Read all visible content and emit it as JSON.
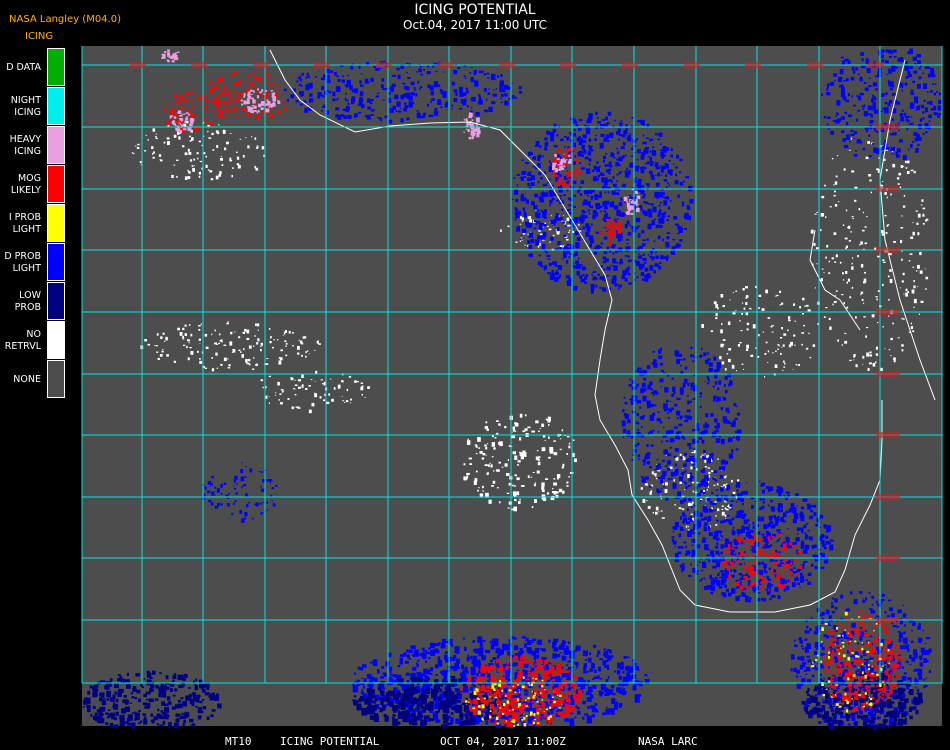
{
  "header": {
    "source": "NASA Langley (M04.0)",
    "product": "ICING",
    "title": "ICING POTENTIAL",
    "subtitle": "Oct.04, 2017 11:00 UTC"
  },
  "legend": [
    {
      "label_lines": [
        "D DATA"
      ],
      "color": "#00b000"
    },
    {
      "label_lines": [
        "NIGHT",
        "ICING"
      ],
      "color": "#00eeee"
    },
    {
      "label_lines": [
        "HEAVY",
        "ICING"
      ],
      "color": "#e8a0e0"
    },
    {
      "label_lines": [
        "MOG",
        "LIKELY"
      ],
      "color": "#ff0000"
    },
    {
      "label_lines": [
        "I PROB",
        "LIGHT"
      ],
      "color": "#ffff00"
    },
    {
      "label_lines": [
        "D PROB",
        "LIGHT"
      ],
      "color": "#0000ff"
    },
    {
      "label_lines": [
        "LOW",
        "PROB"
      ],
      "color": "#000080"
    },
    {
      "label_lines": [
        "NO",
        "RETRVL"
      ],
      "color": "#ffffff"
    },
    {
      "label_lines": [
        "NONE"
      ],
      "color": "#4d4d4d"
    }
  ],
  "footer": {
    "satellite": "MT10",
    "product": "ICING POTENTIAL",
    "date": "OCT 04, 2017 11:00Z",
    "agency": "NASA LARC"
  },
  "colors": {
    "background": "#4d4d4d",
    "grid": "#00e5e5",
    "coast": "#ffffff",
    "grid_labels": "#cc2020"
  }
}
